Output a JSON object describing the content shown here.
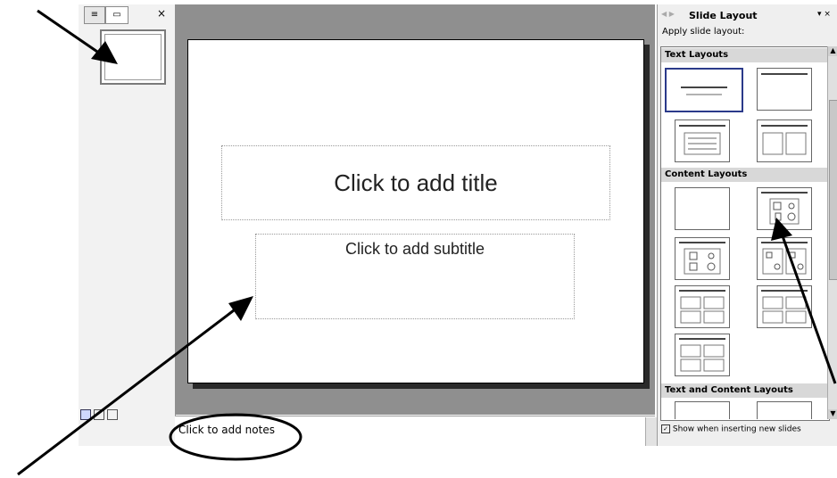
{
  "left_pane": {
    "tab_outline": "≡",
    "tab_slides": "▭",
    "close": "×"
  },
  "slide": {
    "title_placeholder": "Click to add title",
    "subtitle_placeholder": "Click to add subtitle"
  },
  "notes": {
    "placeholder": "Click to add notes"
  },
  "task_pane": {
    "title": "Slide Layout",
    "apply_label": "Apply slide layout:",
    "sections": [
      "Text Layouts",
      "Content Layouts",
      "Text and Content Layouts"
    ],
    "show_checkbox_label": "Show when inserting new slides",
    "show_checked": true
  },
  "colors": {
    "editing_background": "#8f8f8f",
    "selected_layout_border": "#2b3a8a"
  }
}
